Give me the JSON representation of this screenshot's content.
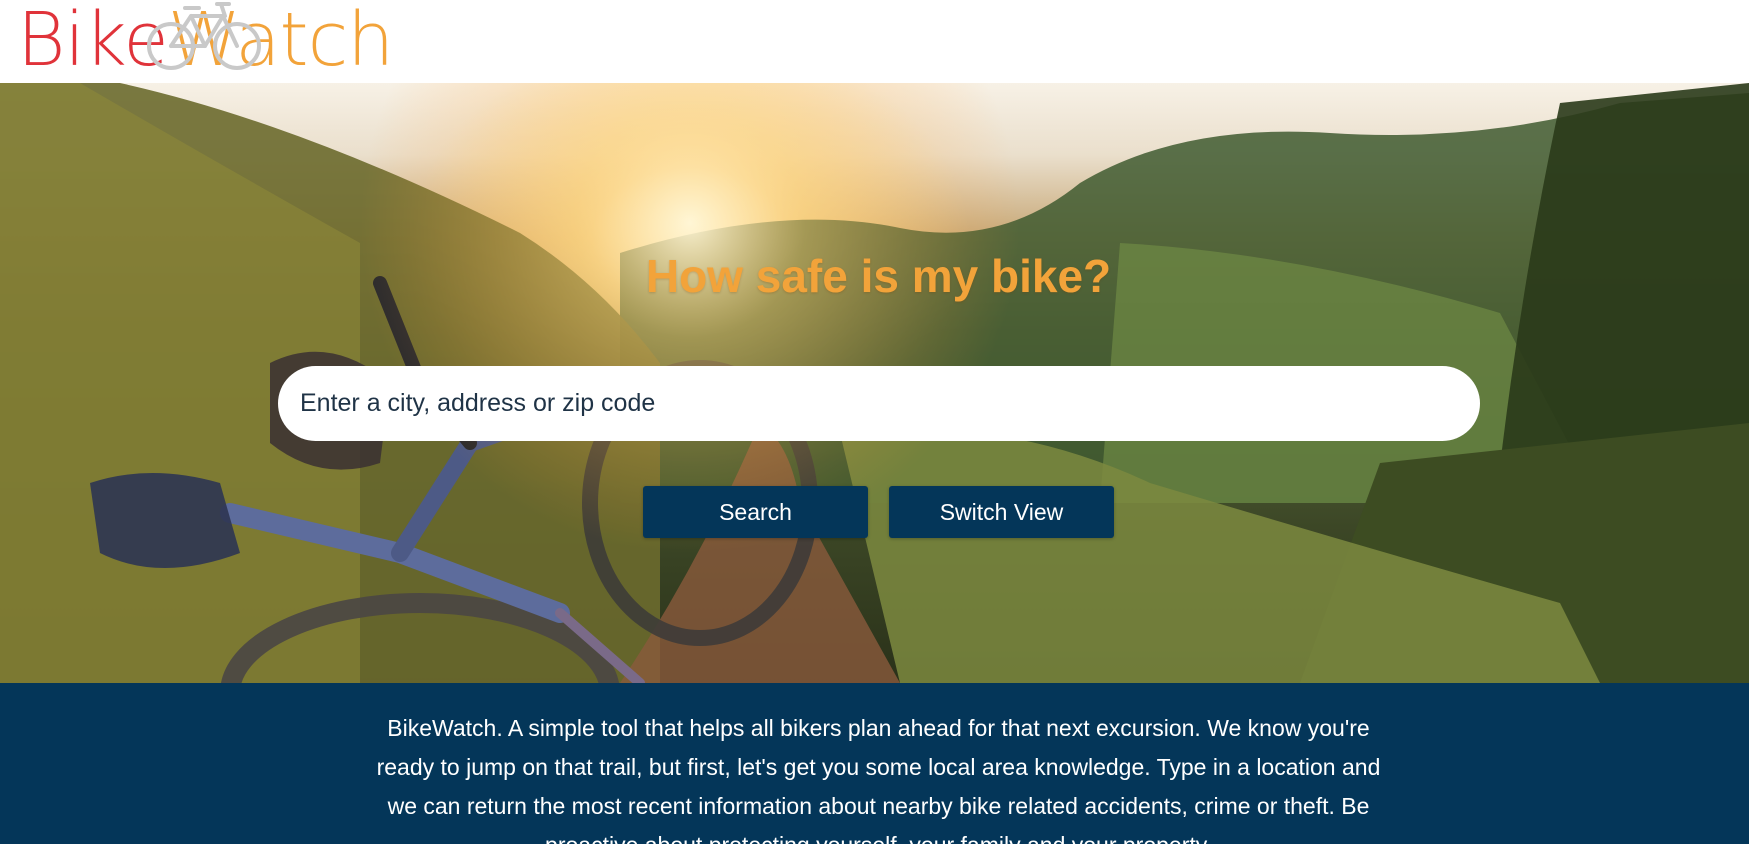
{
  "brand": {
    "name_part1": "Bike",
    "name_part2": "Watch",
    "color_part1": "#e0333a",
    "color_part2": "#f2a33a",
    "icon": "bicycle-icon"
  },
  "hero": {
    "title": "How safe is my bike?",
    "search_placeholder": "Enter a city, address or zip code",
    "search_value": "",
    "search_button_label": "Search",
    "switch_view_button_label": "Switch View",
    "background": "photo of mountain bike lying on a trail at sunset"
  },
  "info": {
    "text": "BikeWatch. A simple tool that helps all bikers plan ahead for that next excursion. We know you're ready to jump on that trail, but first, let's get you some local area knowledge. Type in a location and we can return the most recent information about nearby bike related accidents, crime or theft. Be proactive about protecting yourself, your family and your property."
  },
  "colors": {
    "accent_orange": "#f2a33a",
    "brand_red": "#e0333a",
    "navy": "#043659"
  }
}
